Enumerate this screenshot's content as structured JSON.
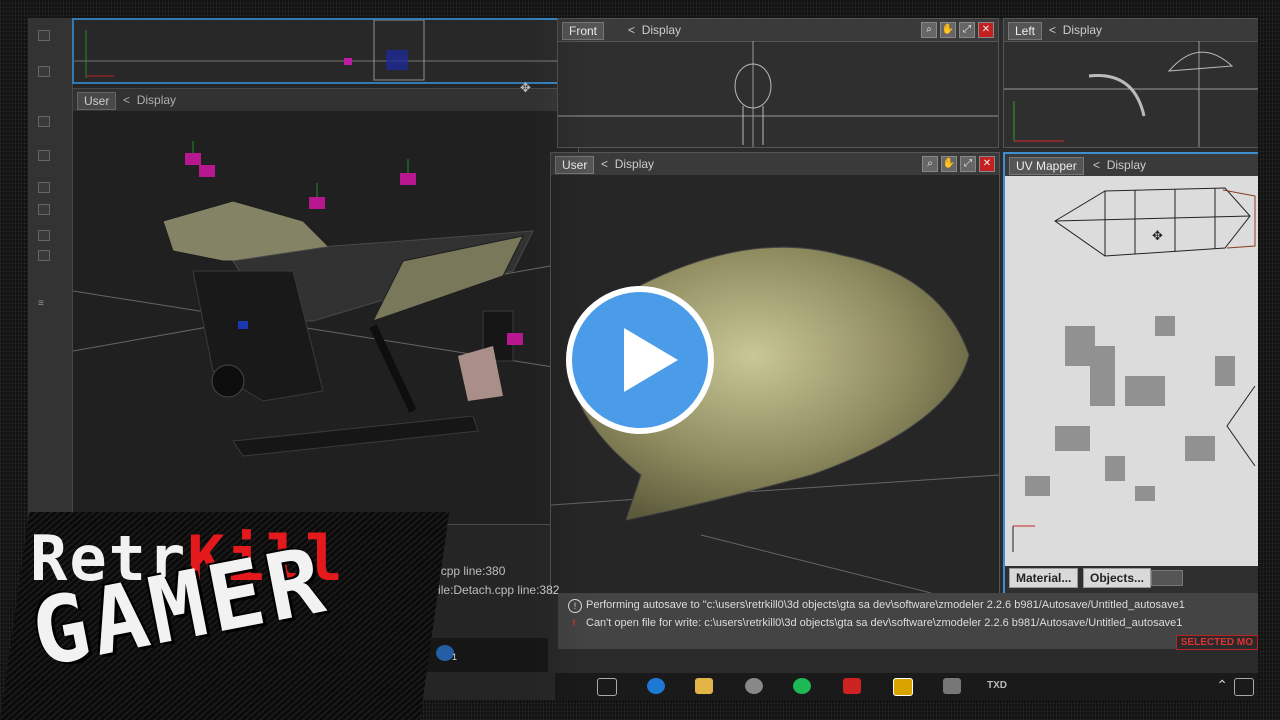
{
  "viewports": {
    "top_left": {
      "label": "",
      "display": ""
    },
    "user_left": {
      "label": "User",
      "display": "Display"
    },
    "front": {
      "label": "Front",
      "display": "Display"
    },
    "left": {
      "label": "Left",
      "display": "Display"
    },
    "user_main": {
      "label": "User",
      "display": "Display"
    },
    "uv_mapper": {
      "label": "UV Mapper",
      "display": "Display"
    }
  },
  "display_prefix": "<",
  "uv_mapper_buttons": {
    "material": "Material...",
    "objects": "Objects..."
  },
  "console_left": {
    "line1": "etach.cpp line:380",
    "line2": "ode. file:Detach.cpp line:382"
  },
  "status": {
    "line1": "Performing autosave to \"c:\\users\\retrkill0\\3d objects\\gta sa dev\\software\\zmodeler 2.2.6 b981/Autosave/Untitled_autosave1",
    "line2": "Can't open file for write: c:\\users\\retrkill0\\3d objects\\gta sa dev\\software\\zmodeler 2.2.6 b981/Autosave/Untitled_autosave1",
    "selected": "SELECTED MO"
  },
  "taskbar_badge": "1",
  "taskbar_txd": "TXD",
  "logo": {
    "part1": "Retr",
    "part2": "Kill",
    "line2": "GAMER"
  },
  "colors": {
    "accent": "#3d8fd1",
    "logo_red": "#e3191b",
    "play": "#4a9ce8",
    "mesh_green": "#b6b58a"
  },
  "icons": [
    "play-icon",
    "info-icon",
    "warning-icon",
    "move-cursor-icon",
    "zoom-icon",
    "pan-icon",
    "maximize-icon",
    "close-icon",
    "task-view-icon",
    "edge-icon",
    "folder-icon",
    "spotify-icon",
    "zmodeler-icon"
  ]
}
